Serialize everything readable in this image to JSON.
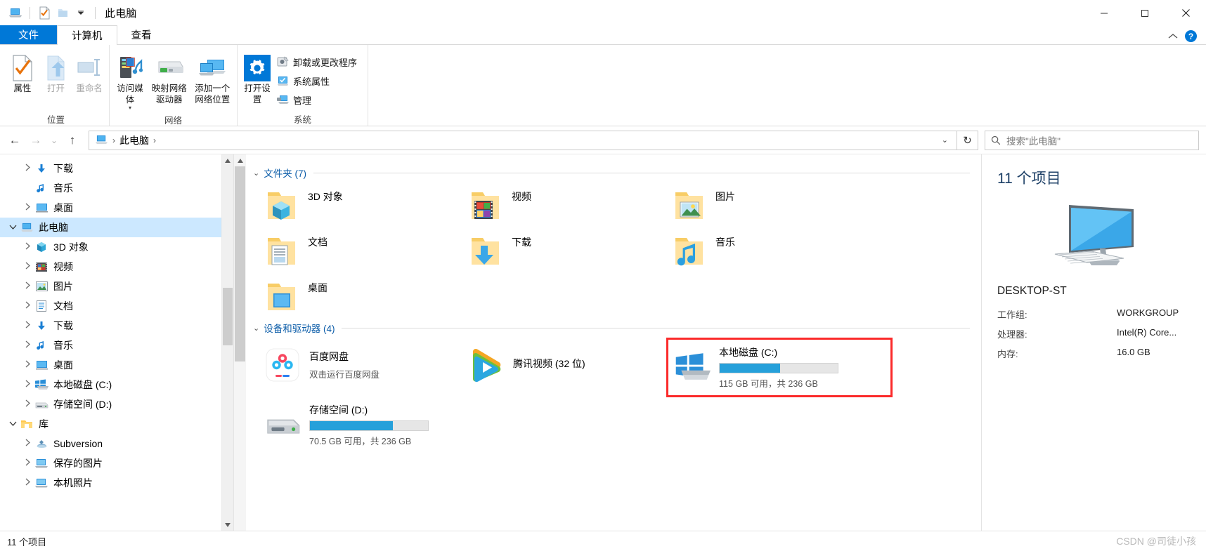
{
  "window": {
    "title": "此电脑",
    "quick_access": [
      "this-pc-icon",
      "properties-check-icon",
      "new-folder-icon",
      "customize-caret"
    ],
    "controls": {
      "minimize": "—",
      "maximize": "▢",
      "close": "✕"
    }
  },
  "tabs": [
    {
      "id": "file",
      "label": "文件"
    },
    {
      "id": "computer",
      "label": "计算机"
    },
    {
      "id": "view",
      "label": "查看"
    }
  ],
  "tab_right": {
    "collapse": "⌃",
    "help": "?"
  },
  "ribbon": {
    "groups": [
      {
        "name": "位置",
        "label": "位置",
        "big_buttons": [
          {
            "label": "属性",
            "icon": "properties-icon",
            "disabled": false
          },
          {
            "label": "打开",
            "icon": "open-icon",
            "disabled": true
          },
          {
            "label": "重命名",
            "icon": "rename-icon",
            "disabled": true
          }
        ],
        "small_buttons": []
      },
      {
        "name": "网络",
        "label": "网络",
        "big_buttons": [
          {
            "label": "访问媒体",
            "icon": "media-server-icon",
            "disabled": false,
            "caret": true
          },
          {
            "label": "映射网络驱动器",
            "icon": "map-drive-icon",
            "disabled": false,
            "caret": true
          },
          {
            "label": "添加一个网络位置",
            "icon": "add-network-location-icon",
            "disabled": false
          }
        ],
        "small_buttons": []
      },
      {
        "name": "系统",
        "label": "系统",
        "big_buttons": [
          {
            "label": "打开设置",
            "icon": "settings-gear-icon",
            "disabled": false
          }
        ],
        "small_buttons": [
          {
            "label": "卸载或更改程序",
            "icon": "uninstall-icon"
          },
          {
            "label": "系统属性",
            "icon": "system-properties-icon"
          },
          {
            "label": "管理",
            "icon": "manage-icon"
          }
        ]
      }
    ]
  },
  "addressbar": {
    "back": "←",
    "forward": "→",
    "recent": "⌄",
    "up": "↑",
    "crumbs": [
      "此电脑"
    ],
    "crumb_caret": "⌄",
    "refresh": "↻"
  },
  "search": {
    "placeholder": "搜索\"此电脑\"",
    "value": "",
    "icon": "search-icon"
  },
  "navpane": {
    "items": [
      {
        "label": "下载",
        "icon": "downloads-icon",
        "indent": 1,
        "chevron": "closed",
        "selected": false
      },
      {
        "label": "音乐",
        "icon": "music-icon",
        "indent": 1,
        "chevron": "none",
        "selected": false
      },
      {
        "label": "桌面",
        "icon": "desktop-icon",
        "indent": 1,
        "chevron": "closed",
        "selected": false
      },
      {
        "label": "此电脑",
        "icon": "this-pc-icon",
        "indent": 0,
        "chevron": "open",
        "selected": true
      },
      {
        "label": "3D 对象",
        "icon": "3d-objects-icon",
        "indent": 1,
        "chevron": "closed",
        "selected": false
      },
      {
        "label": "视频",
        "icon": "videos-icon",
        "indent": 1,
        "chevron": "closed",
        "selected": false
      },
      {
        "label": "图片",
        "icon": "pictures-icon",
        "indent": 1,
        "chevron": "closed",
        "selected": false
      },
      {
        "label": "文档",
        "icon": "documents-icon",
        "indent": 1,
        "chevron": "closed",
        "selected": false
      },
      {
        "label": "下载",
        "icon": "downloads-icon",
        "indent": 1,
        "chevron": "closed",
        "selected": false
      },
      {
        "label": "音乐",
        "icon": "music-icon",
        "indent": 1,
        "chevron": "closed",
        "selected": false
      },
      {
        "label": "桌面",
        "icon": "desktop-icon",
        "indent": 1,
        "chevron": "closed",
        "selected": false
      },
      {
        "label": "本地磁盘 (C:)",
        "icon": "windows-drive-icon",
        "indent": 1,
        "chevron": "closed",
        "selected": false
      },
      {
        "label": "存储空间 (D:)",
        "icon": "drive-icon",
        "indent": 1,
        "chevron": "closed",
        "selected": false
      },
      {
        "label": "库",
        "icon": "library-folder-icon",
        "indent": 0,
        "chevron": "open",
        "selected": false
      },
      {
        "label": "Subversion",
        "icon": "subversion-icon",
        "indent": 1,
        "chevron": "closed",
        "selected": false
      },
      {
        "label": "保存的图片",
        "icon": "saved-pictures-icon",
        "indent": 1,
        "chevron": "closed",
        "selected": false
      },
      {
        "label": "本机照片",
        "icon": "camera-roll-icon",
        "indent": 1,
        "chevron": "closed",
        "selected": false
      }
    ]
  },
  "content": {
    "folders_group": {
      "title": "文件夹 (7)",
      "chevron": "⌄"
    },
    "folders": [
      {
        "label": "3D 对象",
        "icon": "folder-3d-objects-icon"
      },
      {
        "label": "视频",
        "icon": "folder-videos-icon"
      },
      {
        "label": "图片",
        "icon": "folder-pictures-icon"
      },
      {
        "label": "文档",
        "icon": "folder-documents-icon"
      },
      {
        "label": "下载",
        "icon": "folder-downloads-icon"
      },
      {
        "label": "音乐",
        "icon": "folder-music-icon"
      },
      {
        "label": "桌面",
        "icon": "folder-desktop-icon"
      }
    ],
    "devices_group": {
      "title": "设备和驱动器 (4)",
      "chevron": "⌄"
    },
    "devices": [
      {
        "name": "百度网盘",
        "sub": "双击运行百度网盘",
        "icon": "baidu-netdisk-icon",
        "has_bar": false,
        "highlighted": false
      },
      {
        "name": "腾讯视频 (32 位)",
        "sub": "",
        "icon": "tencent-video-icon",
        "has_bar": false,
        "highlighted": false
      },
      {
        "name": "本地磁盘 (C:)",
        "sub": "115 GB 可用，共 236 GB",
        "icon": "windows-drive-icon",
        "has_bar": true,
        "used_percent": 51,
        "bar_color": "#26a0da",
        "highlighted": true
      },
      {
        "name": "存储空间 (D:)",
        "sub": "70.5 GB 可用，共 236 GB",
        "icon": "drive-icon",
        "has_bar": true,
        "used_percent": 70,
        "bar_color": "#26a0da",
        "highlighted": false
      }
    ]
  },
  "details": {
    "title": "11 个项目",
    "image": "desktop-computer-icon",
    "computer_name": "DESKTOP-ST",
    "rows": [
      {
        "key": "工作组:",
        "value": "WORKGROUP"
      },
      {
        "key": "处理器:",
        "value": "Intel(R) Core..."
      },
      {
        "key": "内存:",
        "value": "16.0 GB"
      }
    ]
  },
  "statusbar": {
    "count": "11 个项目"
  },
  "watermark": "CSDN @司徒小孩",
  "colors": {
    "accent": "#0078d7",
    "selection": "#cce8ff",
    "bar_fill": "#26a0da",
    "highlight_border": "#fb2a2a",
    "group_title": "#0b5ca8"
  }
}
